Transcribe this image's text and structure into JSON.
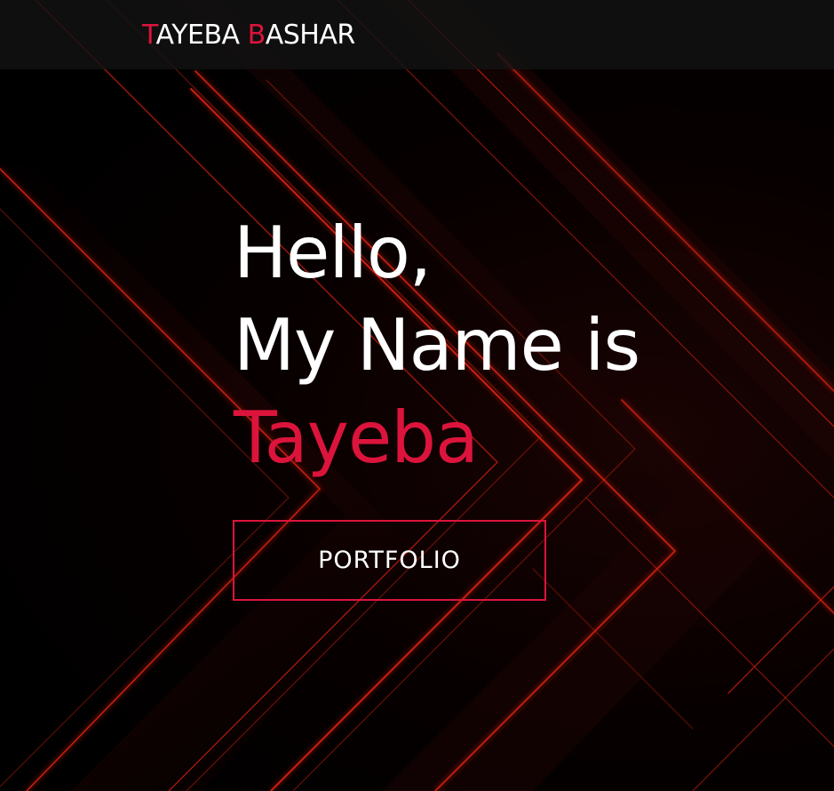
{
  "nav": {
    "logo": {
      "first_initial": "T",
      "first_rest": "AYEBA",
      "last_initial": "B",
      "last_rest": "ASHAR"
    }
  },
  "hero": {
    "line1": "Hello,",
    "line2": "My Name is",
    "name": "Tayeba",
    "button_label": "PORTFOLIO"
  },
  "colors": {
    "accent": "#dc143c",
    "background": "#000000",
    "navbar": "#121212",
    "text": "#ffffff"
  },
  "background_art": "red chevron light streaks"
}
